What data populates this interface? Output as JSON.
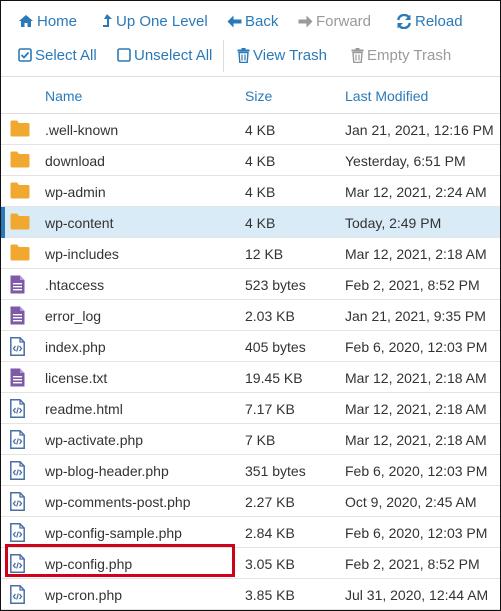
{
  "toolbar": {
    "home": "Home",
    "up_one_level": "Up One Level",
    "back": "Back",
    "forward": "Forward",
    "reload": "Reload",
    "select_all": "Select All",
    "unselect_all": "Unselect All",
    "view_trash": "View Trash",
    "empty_trash": "Empty Trash"
  },
  "columns": {
    "name": "Name",
    "size": "Size",
    "last_modified": "Last Modified"
  },
  "files": [
    {
      "name": ".well-known",
      "size": "4 KB",
      "modified": "Jan 21, 2021, 12:16 PM",
      "type": "folder"
    },
    {
      "name": "download",
      "size": "4 KB",
      "modified": "Yesterday, 6:51 PM",
      "type": "folder"
    },
    {
      "name": "wp-admin",
      "size": "4 KB",
      "modified": "Mar 12, 2021, 2:24 AM",
      "type": "folder"
    },
    {
      "name": "wp-content",
      "size": "4 KB",
      "modified": "Today, 2:49 PM",
      "type": "folder",
      "selected": true
    },
    {
      "name": "wp-includes",
      "size": "12 KB",
      "modified": "Mar 12, 2021, 2:18 AM",
      "type": "folder"
    },
    {
      "name": ".htaccess",
      "size": "523 bytes",
      "modified": "Feb 2, 2021, 8:52 PM",
      "type": "text"
    },
    {
      "name": "error_log",
      "size": "2.03 KB",
      "modified": "Jan 21, 2021, 9:35 PM",
      "type": "text"
    },
    {
      "name": "index.php",
      "size": "405 bytes",
      "modified": "Feb 6, 2020, 12:03 PM",
      "type": "code"
    },
    {
      "name": "license.txt",
      "size": "19.45 KB",
      "modified": "Mar 12, 2021, 2:18 AM",
      "type": "text"
    },
    {
      "name": "readme.html",
      "size": "7.17 KB",
      "modified": "Mar 12, 2021, 2:18 AM",
      "type": "code"
    },
    {
      "name": "wp-activate.php",
      "size": "7 KB",
      "modified": "Mar 12, 2021, 2:18 AM",
      "type": "code"
    },
    {
      "name": "wp-blog-header.php",
      "size": "351 bytes",
      "modified": "Feb 6, 2020, 12:03 PM",
      "type": "code"
    },
    {
      "name": "wp-comments-post.php",
      "size": "2.27 KB",
      "modified": "Oct 9, 2020, 2:45 AM",
      "type": "code"
    },
    {
      "name": "wp-config-sample.php",
      "size": "2.84 KB",
      "modified": "Feb 6, 2020, 12:03 PM",
      "type": "code"
    },
    {
      "name": "wp-config.php",
      "size": "3.05 KB",
      "modified": "Feb 2, 2021, 8:52 PM",
      "type": "code",
      "highlighted": true
    },
    {
      "name": "wp-cron.php",
      "size": "3.85 KB",
      "modified": "Jul 31, 2020, 12:44 AM",
      "type": "code"
    }
  ],
  "colors": {
    "accent": "#2a7ab8",
    "folder": "#f0a830",
    "text_file": "#7d5ba6",
    "code_file": "#4a6fa5",
    "selected_row": "#d9ebf7",
    "highlight_box": "#d0021b",
    "disabled": "#9a9a9a"
  },
  "icons": {
    "folder": "folder-icon",
    "text": "text-file-icon",
    "code": "code-file-icon"
  }
}
